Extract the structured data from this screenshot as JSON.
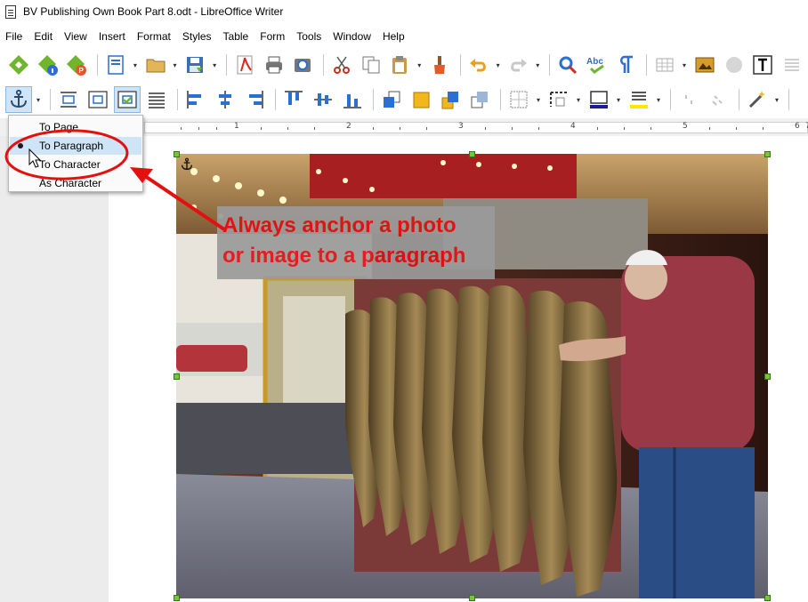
{
  "window": {
    "title": "BV Publishing Own Book Part 8.odt - LibreOffice Writer"
  },
  "menubar": {
    "items": [
      {
        "label": "File"
      },
      {
        "label": "Edit"
      },
      {
        "label": "View"
      },
      {
        "label": "Insert"
      },
      {
        "label": "Format"
      },
      {
        "label": "Styles"
      },
      {
        "label": "Table"
      },
      {
        "label": "Form"
      },
      {
        "label": "Tools"
      },
      {
        "label": "Window"
      },
      {
        "label": "Help"
      }
    ]
  },
  "anchor_menu": {
    "items": [
      {
        "label": "To Page",
        "selected": false
      },
      {
        "label": "To Paragraph",
        "selected": true
      },
      {
        "label": "To Character",
        "selected": false
      },
      {
        "label": "As Character",
        "selected": false
      }
    ]
  },
  "ruler": {
    "labels": [
      "1",
      "2",
      "3",
      "4",
      "5",
      "6",
      "7"
    ]
  },
  "annotation": {
    "line1": "Always anchor a photo",
    "line2": "or image to a paragraph"
  },
  "colors": {
    "annotation_text": "#e41010",
    "selection_handle": "#78c43a",
    "active_button": "#cfe4f7"
  }
}
